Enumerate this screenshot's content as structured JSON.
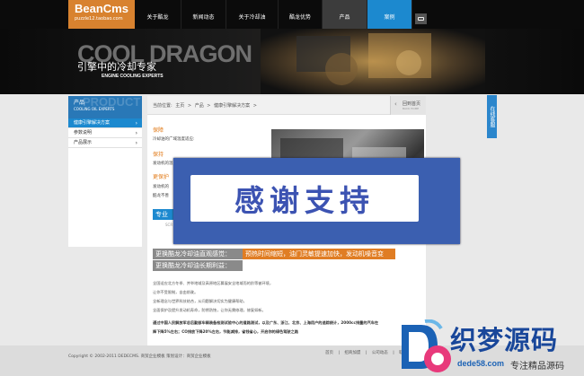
{
  "header": {
    "logo_brand": "BeanCms",
    "logo_sub": "puzzle12.taobao.com",
    "nav": [
      {
        "label": "关于酷龙"
      },
      {
        "label": "新闻动态"
      },
      {
        "label": "关于冷却油"
      },
      {
        "label": "酷龙优势"
      },
      {
        "label": "产品"
      },
      {
        "label": "案例"
      }
    ]
  },
  "banner": {
    "big_text": "COOL DRAGON",
    "slogan": "引擎中的冷却专家",
    "slogan_en": "ENGINE COOLING EXPERTS"
  },
  "sidebar": {
    "ghost": "PRODUCT",
    "title": "产品",
    "subtitle": "COOLING OIL EXPERTS",
    "items": [
      {
        "label": "健康引擎解决方案"
      },
      {
        "label": "参数说明"
      },
      {
        "label": "产品展示"
      }
    ]
  },
  "main": {
    "breadcrumb": [
      "当前位置:",
      "主页",
      ">",
      "产品",
      ">",
      "健康引擎解决方案",
      ">"
    ],
    "back_label": "回到首页",
    "back_en": "BACK HOME",
    "sec1_title": "保障",
    "sec1_text": "冷却油的广域温度适应:",
    "sec2_title": "保持",
    "sec2_text": "发动机的温",
    "sec3_title": "更保护",
    "sec3_text1": "发动机的",
    "sec3_text2": "酷龙不善",
    "pro_label": "专业",
    "ghost_code": "SCR",
    "adv1_left": "更换酷龙冷却油直观感觉：",
    "adv1_right": "预热时间缩短，油门灵敏提速加快，发动机噪音变轻。",
    "adv2_left": "更换酷龙冷却油长期利益：",
    "paras": [
      "全国适应北方冬季、并举地域及高原地区募展安全地域而的阶等被环境，",
      "让你不受限制，自由前驶。",
      "全新理念与世界科技结合，从问题解决切实为健康帮助，",
      "全面保护及提升发动机寿命，防锈防蚀，让你无需修理，修复如新。",
      "通过中国人民解放军总后勤部车辆装备检测试验中心的道路测试，以及广东、浙江、北京、上海用户的追踪统计，2000cc排量的汽车在",
      "降下降5%左右；CO排放下降20%左右，节能减排，省钱省心，开启你的绿色驾驶之路"
    ]
  },
  "overlay": {
    "text": "感谢支持"
  },
  "float": {
    "label": "在线客服"
  },
  "footer": {
    "copyright": "Copyright © 2002-2011 DEDECMS. 商贸企业模板    策划设计：商贸企业模板",
    "links": [
      "首页",
      "|",
      "招商加盟",
      "|",
      "公司动态",
      "|",
      "联系"
    ]
  },
  "watermark": {
    "text": "织梦源码",
    "url": "dede58.com",
    "sub": "专注精品源码"
  }
}
